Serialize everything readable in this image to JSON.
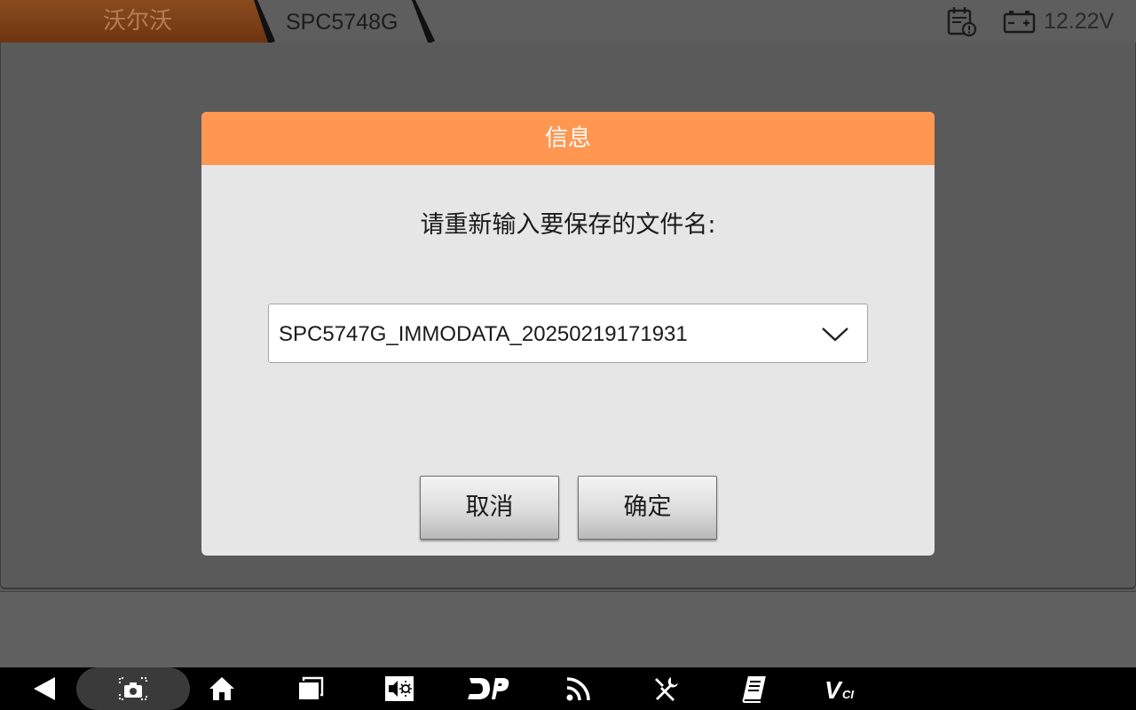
{
  "topbar": {
    "breadcrumb": [
      {
        "label": "沃尔沃"
      },
      {
        "label": "SPC5748G"
      }
    ],
    "voltage": "12.22V",
    "icons": [
      "calendar-alert-icon",
      "battery-icon"
    ]
  },
  "dialog": {
    "title": "信息",
    "message": "请重新输入要保存的文件名:",
    "filename_value": "SPC5747G_IMMODATA_20250219171931",
    "buttons": {
      "cancel_label": "取消",
      "ok_label": "确定"
    }
  },
  "navbar": {
    "items": [
      {
        "icon": "back-icon"
      },
      {
        "icon": "screenshot-icon"
      },
      {
        "icon": "home-icon"
      },
      {
        "icon": "recent-apps-icon"
      },
      {
        "icon": "volume-brightness-icon"
      },
      {
        "icon": "dp-icon"
      },
      {
        "icon": "signal-icon"
      },
      {
        "icon": "tools-icon"
      },
      {
        "icon": "report-icon"
      },
      {
        "icon": "vci-icon"
      }
    ],
    "vci_text": "V",
    "vci_sub": "CI"
  },
  "colors": {
    "dialog_header": "#ff9751",
    "breadcrumb_active": "#8a4b1e",
    "background": "#585858"
  }
}
